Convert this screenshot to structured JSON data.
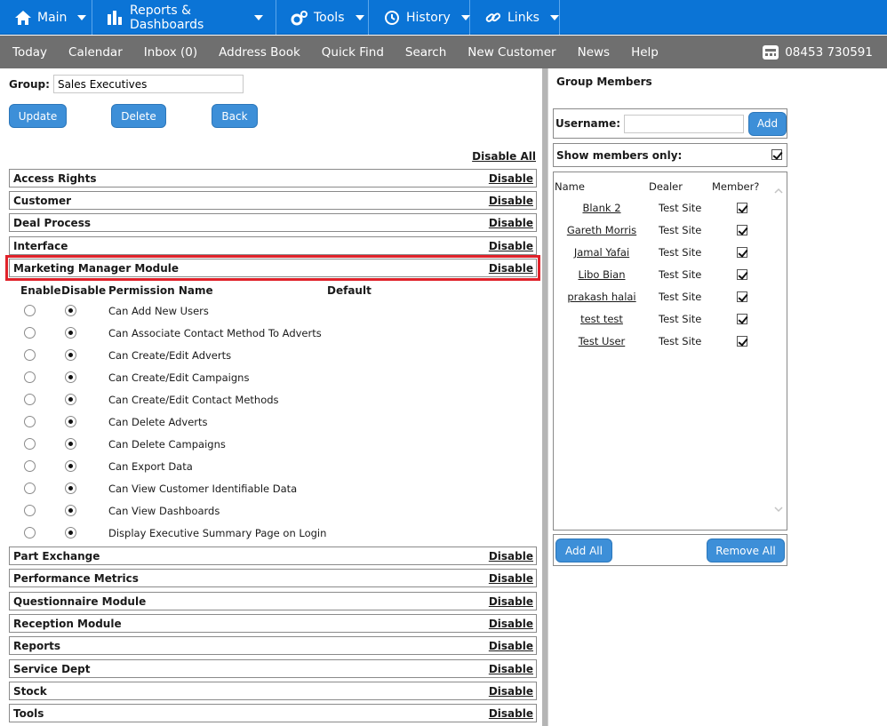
{
  "topnav": [
    {
      "label": "Main",
      "icon": "home-icon"
    },
    {
      "label": "Reports & Dashboards",
      "icon": "bar-chart-icon"
    },
    {
      "label": "Tools",
      "icon": "gears-icon"
    },
    {
      "label": "History",
      "icon": "history-icon"
    },
    {
      "label": "Links",
      "icon": "link-icon"
    }
  ],
  "subnav": [
    "Today",
    "Calendar",
    "Inbox (0)",
    "Address Book",
    "Quick Find",
    "Search",
    "New Customer",
    "News",
    "Help"
  ],
  "phone": "08453 730591",
  "group": {
    "label": "Group:",
    "value": "Sales Executives"
  },
  "buttons": {
    "update": "Update",
    "delete": "Delete",
    "back": "Back"
  },
  "disable_all": "Disable All",
  "disable_label": "Disable",
  "sections_top": [
    "Access Rights",
    "Customer",
    "Deal Process",
    "Interface",
    "Marketing Manager Module"
  ],
  "sections_bottom": [
    "Part Exchange",
    "Performance Metrics",
    "Questionnaire Module",
    "Reception Module",
    "Reports",
    "Service Dept",
    "Stock",
    "Tools"
  ],
  "perm_headers": {
    "enable": "Enable",
    "disable": "Disable",
    "name": "Permission Name",
    "default": "Default"
  },
  "permissions": [
    {
      "name": "Can Add New Users",
      "state": "disable"
    },
    {
      "name": "Can Associate Contact Method To Adverts",
      "state": "disable"
    },
    {
      "name": "Can Create/Edit Adverts",
      "state": "disable"
    },
    {
      "name": "Can Create/Edit Campaigns",
      "state": "disable"
    },
    {
      "name": "Can Create/Edit Contact Methods",
      "state": "disable"
    },
    {
      "name": "Can Delete Adverts",
      "state": "disable"
    },
    {
      "name": "Can Delete Campaigns",
      "state": "disable"
    },
    {
      "name": "Can Export Data",
      "state": "disable"
    },
    {
      "name": "Can View Customer Identifiable Data",
      "state": "disable"
    },
    {
      "name": "Can View Dashboards",
      "state": "disable"
    },
    {
      "name": "Display Executive Summary Page on Login",
      "state": "disable"
    }
  ],
  "members": {
    "title": "Group Members",
    "username_label": "Username:",
    "add_label": "Add",
    "show_members_label": "Show members only:",
    "show_members_checked": true,
    "headers": {
      "name": "Name",
      "dealer": "Dealer",
      "member": "Member?"
    },
    "rows": [
      {
        "name": "Blank 2",
        "dealer": "Test Site",
        "member": true
      },
      {
        "name": "Gareth Morris",
        "dealer": "Test Site",
        "member": true
      },
      {
        "name": "Jamal Yafai",
        "dealer": "Test Site",
        "member": true
      },
      {
        "name": "Libo Bian",
        "dealer": "Test Site",
        "member": true
      },
      {
        "name": "prakash halai",
        "dealer": "Test Site",
        "member": true
      },
      {
        "name": "test test",
        "dealer": "Test Site",
        "member": true
      },
      {
        "name": "Test User",
        "dealer": "Test Site",
        "member": true
      }
    ],
    "add_all": "Add All",
    "remove_all": "Remove All"
  },
  "colors": {
    "nav_blue": "#0b74d6",
    "subnav_grey": "#6f6f6f",
    "button_blue": "#3d8fd8",
    "highlight_red": "#e0222a"
  }
}
